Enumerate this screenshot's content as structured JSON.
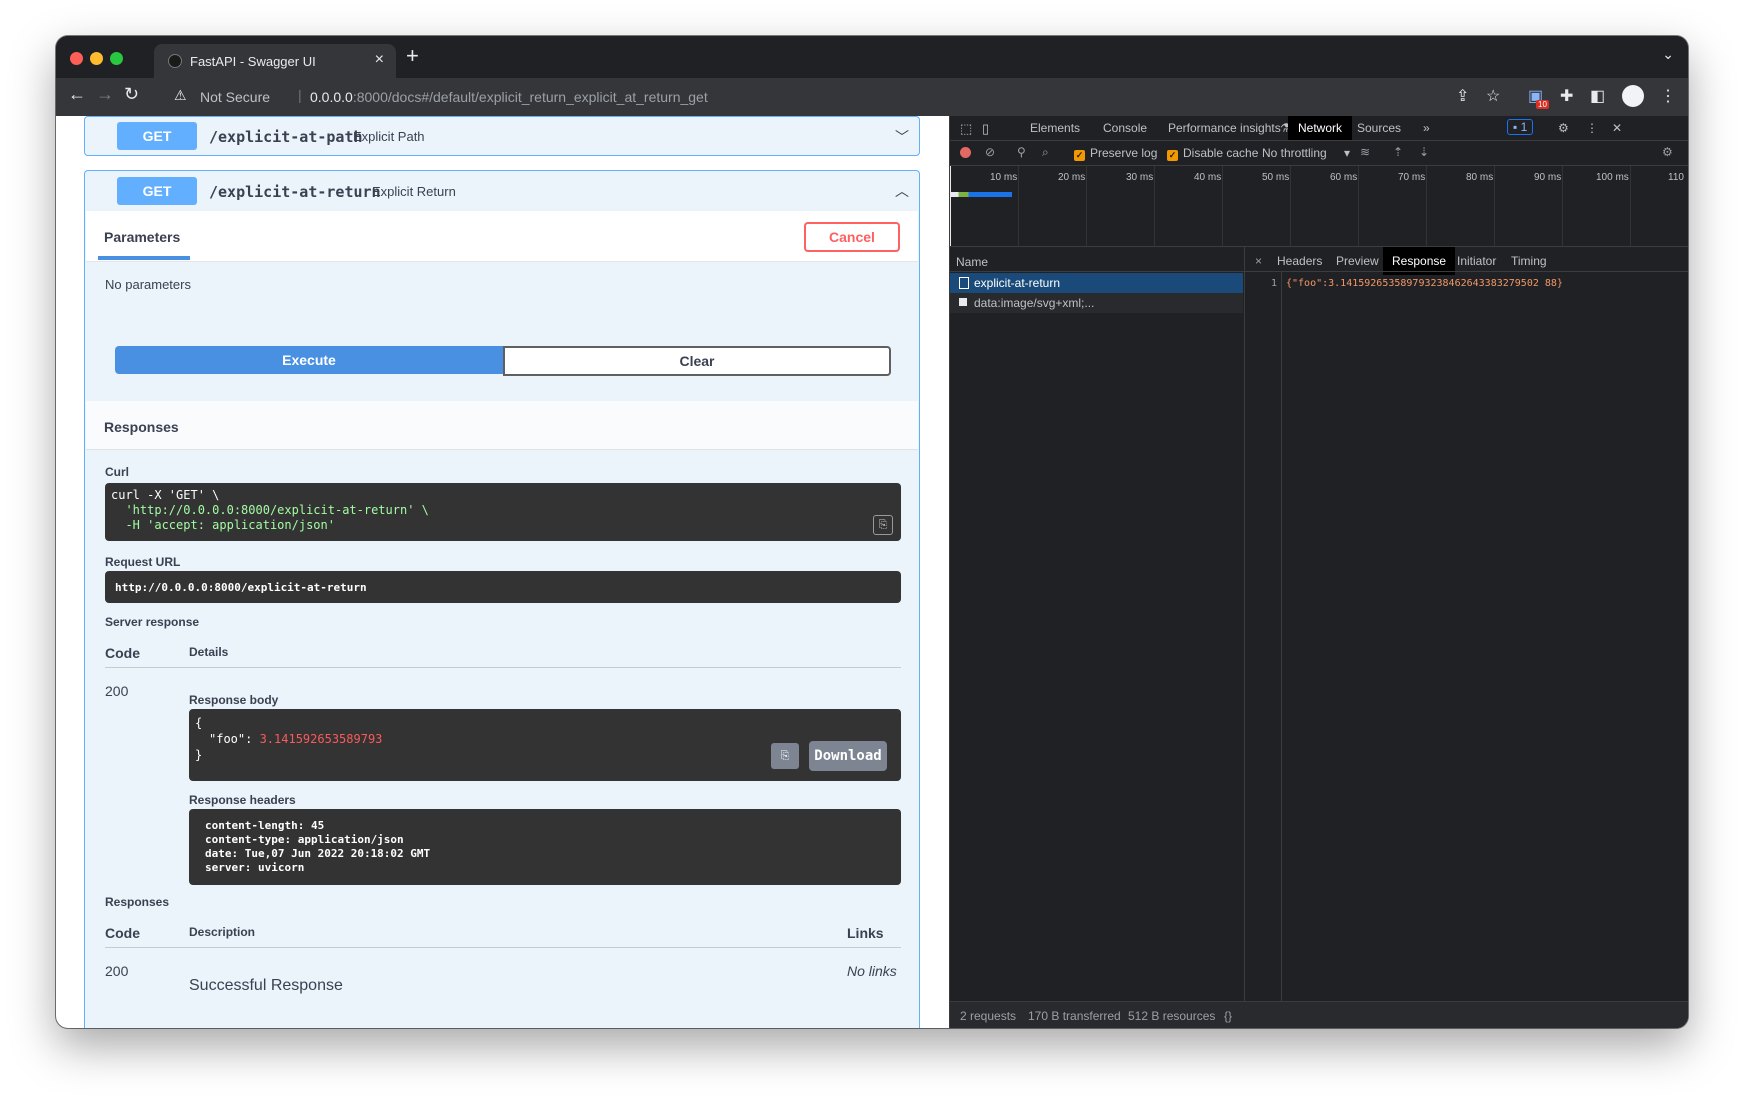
{
  "browser": {
    "tab_title": "FastAPI - Swagger UI",
    "security_label": "Not Secure",
    "url_host": "0.0.0.0",
    "url_rest": ":8000/docs#/default/explicit_return_explicit_at_return_get",
    "ext_badge": "10"
  },
  "swagger": {
    "op1": {
      "method": "GET",
      "path": "/explicit-at-path",
      "summary": "Explicit Path"
    },
    "op2": {
      "method": "GET",
      "path": "/explicit-at-return",
      "summary": "Explicit Return"
    },
    "parameters_title": "Parameters",
    "cancel_label": "Cancel",
    "no_parameters": "No parameters",
    "execute_label": "Execute",
    "clear_label": "Clear",
    "responses_title": "Responses",
    "curl_label": "Curl",
    "curl_lines": [
      "curl -X 'GET' \\",
      "  'http://0.0.0.0:8000/explicit-at-return' \\",
      "  -H 'accept: application/json'"
    ],
    "request_url_label": "Request URL",
    "request_url": "http://0.0.0.0:8000/explicit-at-return",
    "server_response_label": "Server response",
    "code_header": "Code",
    "details_header": "Details",
    "response_code": "200",
    "response_body_label": "Response body",
    "body_open": "{",
    "body_key": "\"foo\": ",
    "body_value": "3.141592653589793",
    "body_close": "}",
    "download_label": "Download",
    "response_headers_label": "Response headers",
    "headers_lines": [
      "content-length: 45",
      "content-type: application/json",
      "date: Tue,07 Jun 2022 20:18:02 GMT",
      "server: uvicorn"
    ],
    "responses_label2": "Responses",
    "description_header": "Description",
    "links_header": "Links",
    "resp_row_code": "200",
    "resp_row_desc": "Successful Response",
    "resp_row_links": "No links"
  },
  "devtools": {
    "tabs": [
      "Elements",
      "Console",
      "Performance insights",
      "Network",
      "Sources"
    ],
    "active_tab": "Network",
    "issues_count": "1",
    "preserve_log": "Preserve log",
    "disable_cache": "Disable cache",
    "throttling": "No throttling",
    "ticks": [
      "10 ms",
      "20 ms",
      "30 ms",
      "40 ms",
      "50 ms",
      "60 ms",
      "70 ms",
      "80 ms",
      "90 ms",
      "100 ms",
      "110"
    ],
    "name_header": "Name",
    "requests": [
      "explicit-at-return",
      "data:image/svg+xml;..."
    ],
    "detail_tabs": [
      "Headers",
      "Preview",
      "Response",
      "Initiator",
      "Timing"
    ],
    "active_detail_tab": "Response",
    "line_no": "1",
    "response_json_key": "{\"foo\"",
    "response_json_value": ":3.141592653589793238462643383279502 88}",
    "response_text": "{\"foo\":3.141592653589793238462643383279502 88}",
    "status_requests": "2 requests",
    "status_transferred": "170 B transferred",
    "status_resources": "512 B resources",
    "pretty_print": "{}"
  },
  "colors": {
    "get_method": "#61affe",
    "cancel": "#ff6060",
    "execute": "#4990e2",
    "json_value": "#f85b5b"
  }
}
